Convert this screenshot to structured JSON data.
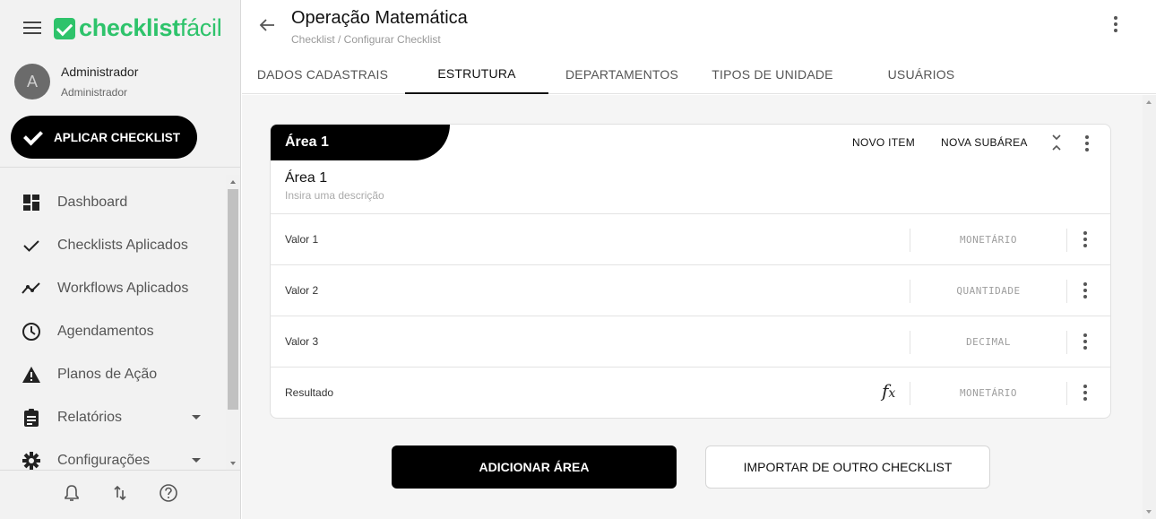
{
  "sidebar": {
    "logo": {
      "part1": "checklist",
      "part2": "fácil"
    },
    "user": {
      "initial": "A",
      "name": "Administrador",
      "role": "Administrador"
    },
    "apply_button": "APLICAR CHECKLIST",
    "items": [
      {
        "label": "Dashboard",
        "icon": "dashboard-icon"
      },
      {
        "label": "Checklists Aplicados",
        "icon": "check-icon"
      },
      {
        "label": "Workflows Aplicados",
        "icon": "trending-icon"
      },
      {
        "label": "Agendamentos",
        "icon": "clock-icon"
      },
      {
        "label": "Planos de Ação",
        "icon": "warning-icon"
      },
      {
        "label": "Relatórios",
        "icon": "clipboard-icon",
        "has_submenu": true
      },
      {
        "label": "Configurações",
        "icon": "gear-icon",
        "has_submenu": true
      }
    ],
    "footer_icons": [
      "bell-icon",
      "sync-icon",
      "help-icon"
    ]
  },
  "header": {
    "title": "Operação Matemática",
    "breadcrumb": "Checklist / Configurar Checklist",
    "tabs": [
      {
        "label": "DADOS CADASTRAIS",
        "active": false
      },
      {
        "label": "ESTRUTURA",
        "active": true
      },
      {
        "label": "DEPARTAMENTOS",
        "active": false
      },
      {
        "label": "TIPOS DE UNIDADE",
        "active": false
      },
      {
        "label": "USUÁRIOS",
        "active": false
      }
    ]
  },
  "area": {
    "tag": "Área 1",
    "new_item": "NOVO ITEM",
    "new_subarea": "NOVA SUBÁREA",
    "name": "Área 1",
    "description_placeholder": "Insira uma descrição",
    "items": [
      {
        "label": "Valor 1",
        "type": "MONETÁRIO",
        "formula": false
      },
      {
        "label": "Valor 2",
        "type": "QUANTIDADE",
        "formula": false
      },
      {
        "label": "Valor 3",
        "type": "DECIMAL",
        "formula": false
      },
      {
        "label": "Resultado",
        "type": "MONETÁRIO",
        "formula": true,
        "formula_symbol": "fx"
      }
    ]
  },
  "actions": {
    "add_area": "ADICIONAR ÁREA",
    "import": "IMPORTAR DE OUTRO CHECKLIST"
  },
  "colors": {
    "brand": "#2ec36b",
    "primary": "#000000"
  }
}
